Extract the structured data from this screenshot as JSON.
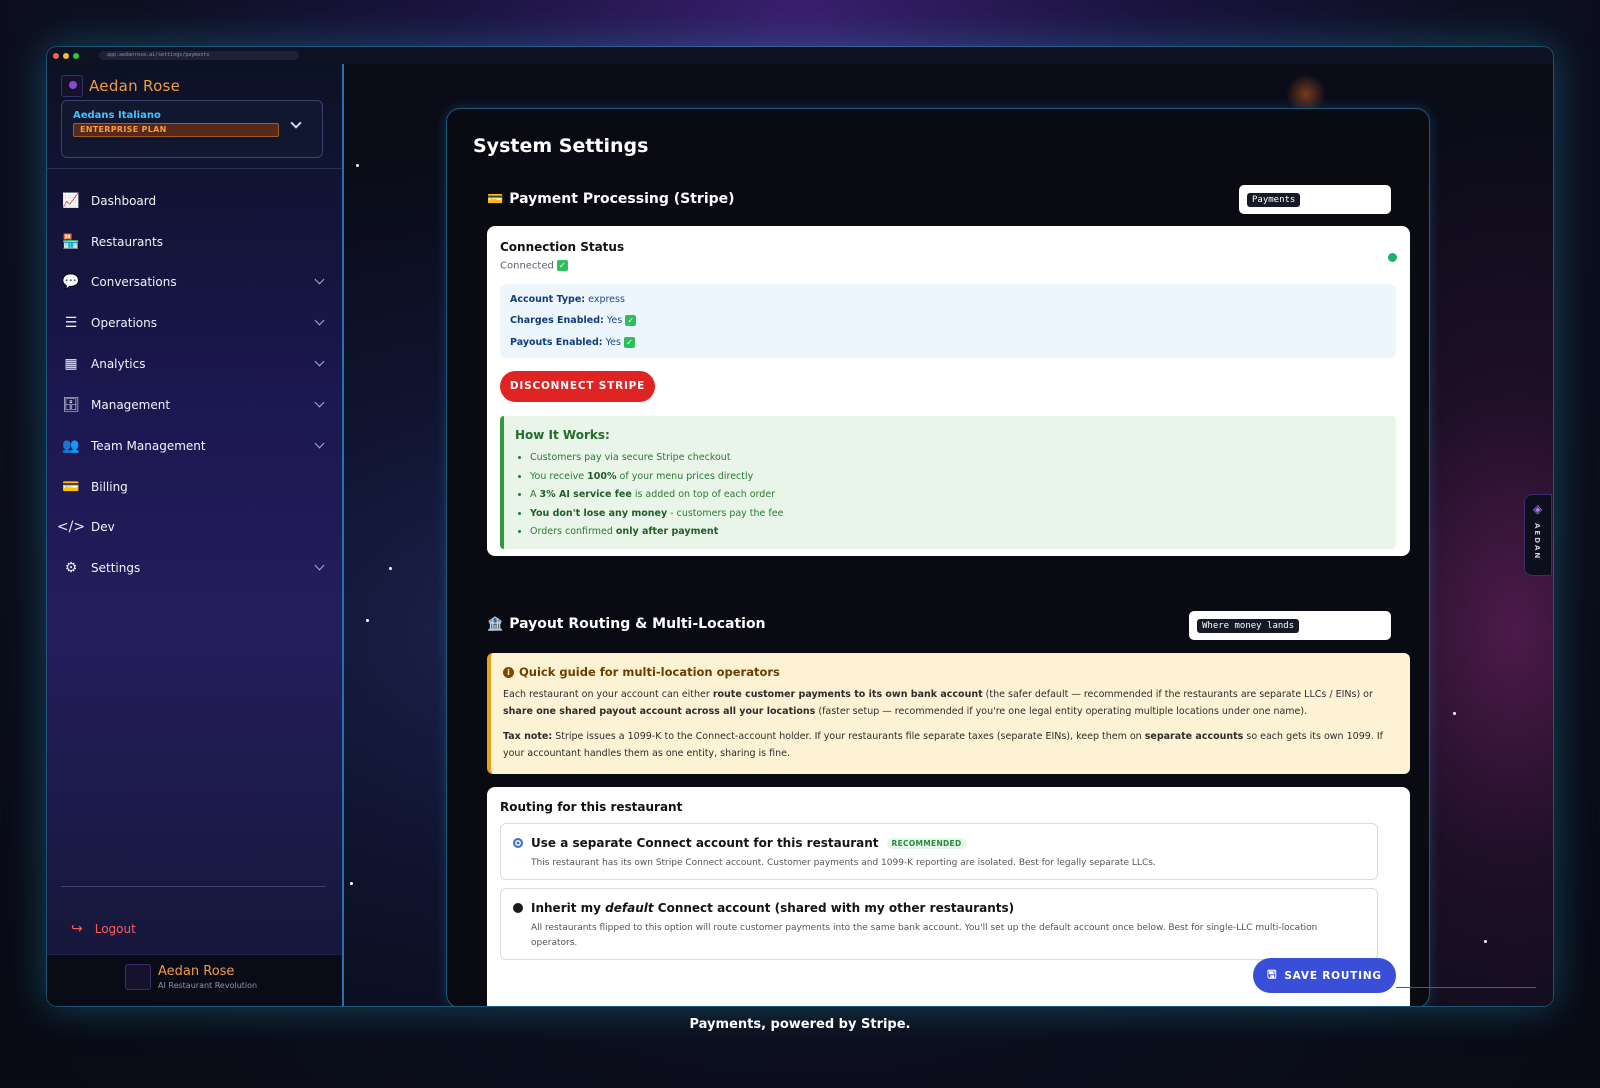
{
  "browser": {
    "url": "app.aedanrose.ai/settings/payments"
  },
  "sidebar": {
    "brand": "Aedan Rose",
    "account": {
      "name": "Aedans Italiano",
      "plan": "ENTERPRISE PLAN"
    },
    "items": [
      {
        "label": "Dashboard",
        "icon": "chart-line-icon",
        "glyph": "📈"
      },
      {
        "label": "Restaurants",
        "icon": "store-icon",
        "glyph": "🏪"
      },
      {
        "label": "Conversations",
        "icon": "chat-bubbles-icon",
        "glyph": "💬"
      },
      {
        "label": "Operations",
        "icon": "list-check-icon",
        "glyph": "☰"
      },
      {
        "label": "Analytics",
        "icon": "bar-chart-icon",
        "glyph": "▦"
      },
      {
        "label": "Management",
        "icon": "database-icon",
        "glyph": "🗄"
      },
      {
        "label": "Team Management",
        "icon": "users-icon",
        "glyph": "👥"
      },
      {
        "label": "Billing",
        "icon": "credit-card-icon",
        "glyph": "💳"
      },
      {
        "label": "Dev",
        "icon": "code-icon",
        "glyph": "</>"
      },
      {
        "label": "Settings",
        "icon": "gear-icon",
        "glyph": "⚙"
      }
    ],
    "logout_label": "Logout",
    "footer": {
      "name": "Aedan Rose",
      "tagline": "AI Restaurant Revolution"
    }
  },
  "main": {
    "page_title": "System Settings",
    "payment": {
      "title": "Payment Processing (Stripe)",
      "emoji": "💳",
      "tag": "Payments",
      "connection_title": "Connection Status",
      "connection_value": "Connected",
      "account_type_label": "Account Type:",
      "account_type_value": "express",
      "charges_label": "Charges Enabled:",
      "charges_value": "Yes",
      "payouts_label": "Payouts Enabled:",
      "payouts_value": "Yes",
      "disconnect_label": "DISCONNECT STRIPE",
      "how_title": "How It Works:",
      "how_items": [
        [
          "Customers pay via secure Stripe checkout",
          "",
          ""
        ],
        [
          "You receive ",
          "100%",
          " of your menu prices directly"
        ],
        [
          "A ",
          "3% AI service fee",
          " is added on top of each order"
        ],
        [
          "",
          "You don't lose any money",
          " - customers pay the fee"
        ],
        [
          "Orders confirmed ",
          "only after payment",
          ""
        ]
      ]
    },
    "payout": {
      "title": "Payout Routing & Multi-Location",
      "emoji": "🏦",
      "tag": "Where money lands",
      "guide_title": "Quick guide for multi-location operators",
      "guide_p1": [
        "Each restaurant on your account can either ",
        "route customer payments to its own bank account",
        " (the safer default — recommended if the restaurants are separate LLCs / EINs) or ",
        "share one shared payout account across all your locations",
        " (faster setup — recommended if you're one legal entity operating multiple locations under one name)."
      ],
      "guide_p2": [
        "Tax note:",
        " Stripe issues a 1099-K to the Connect-account holder. If your restaurants file separate taxes (separate EINs), keep them on ",
        "separate accounts",
        " so each gets its own 1099. If your accountant handles them as one entity, sharing is fine."
      ],
      "routing_title": "Routing for this restaurant",
      "option1_title": "Use a separate Connect account for this restaurant",
      "option1_badge": "RECOMMENDED",
      "option1_desc": "This restaurant has its own Stripe Connect account. Customer payments and 1099-K reporting are isolated. Best for legally separate LLCs.",
      "option2_title_pre": "Inherit my ",
      "option2_title_em": "default",
      "option2_title_post": " Connect account (shared with my other restaurants)",
      "option2_desc": "All restaurants flipped to this option will route customer payments into the same bank account. You'll set up the default account once below. Best for single-LLC multi-location operators.",
      "save_label": "SAVE ROUTING"
    }
  },
  "side_tab": {
    "label": "AEDAN"
  },
  "caption": "Payments, powered by Stripe.",
  "colors": {
    "accent": "#3a4fd8",
    "danger": "#e02424",
    "success": "#19b36b",
    "brand": "#f29a45",
    "plan": "#ff9a3c"
  }
}
